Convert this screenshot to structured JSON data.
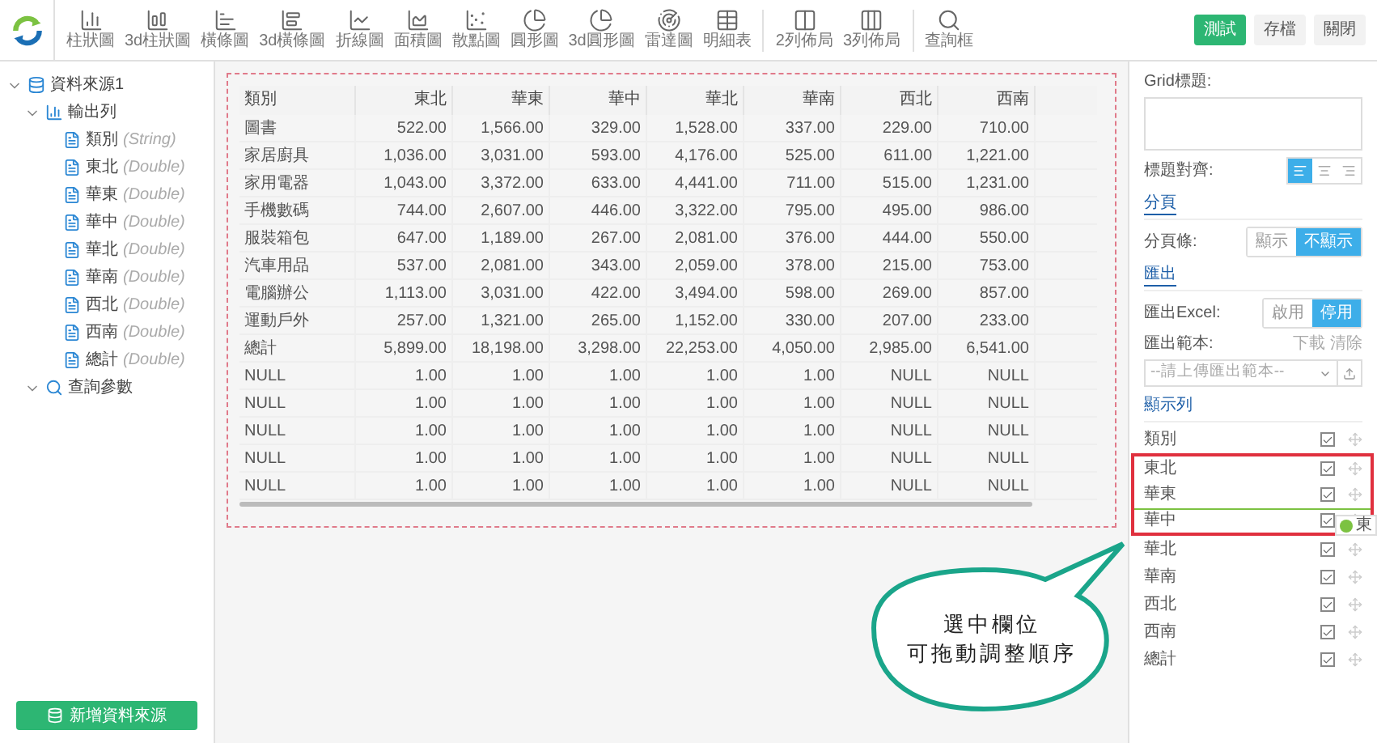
{
  "toolbar": {
    "tools": [
      {
        "kind": "column",
        "label": "柱狀圖"
      },
      {
        "kind": "column3d",
        "label": "3d柱狀圖"
      },
      {
        "kind": "bar",
        "label": "橫條圖"
      },
      {
        "kind": "bar3d",
        "label": "3d橫條圖"
      },
      {
        "kind": "line",
        "label": "折線圖"
      },
      {
        "kind": "area",
        "label": "面積圖"
      },
      {
        "kind": "scatter",
        "label": "散點圖"
      },
      {
        "kind": "pie",
        "label": "圓形圖"
      },
      {
        "kind": "pie3d",
        "label": "3d圓形圖"
      },
      {
        "kind": "radar",
        "label": "雷達圖"
      },
      {
        "kind": "table",
        "label": "明細表"
      },
      {
        "kind": "cols2",
        "label": "2列佈局"
      },
      {
        "kind": "cols3",
        "label": "3列佈局"
      },
      {
        "kind": "query",
        "label": "查詢框"
      }
    ],
    "actions": [
      {
        "label": "測試",
        "primary": true
      },
      {
        "label": "存檔",
        "primary": false
      },
      {
        "label": "關閉",
        "primary": false
      }
    ]
  },
  "sidebar": {
    "tree": [
      {
        "kind": "source",
        "label": "資料來源1",
        "expanded": true,
        "children": [
          {
            "kind": "group",
            "label": "輸出列",
            "expanded": true,
            "children": [
              {
                "kind": "field",
                "label": "類別",
                "type": "(String)"
              },
              {
                "kind": "field",
                "label": "東北",
                "type": "(Double)"
              },
              {
                "kind": "field",
                "label": "華東",
                "type": "(Double)"
              },
              {
                "kind": "field",
                "label": "華中",
                "type": "(Double)"
              },
              {
                "kind": "field",
                "label": "華北",
                "type": "(Double)"
              },
              {
                "kind": "field",
                "label": "華南",
                "type": "(Double)"
              },
              {
                "kind": "field",
                "label": "西北",
                "type": "(Double)"
              },
              {
                "kind": "field",
                "label": "西南",
                "type": "(Double)"
              },
              {
                "kind": "field",
                "label": "總計",
                "type": "(Double)"
              }
            ]
          },
          {
            "kind": "query",
            "label": "查詢參數",
            "expanded": true
          }
        ]
      }
    ],
    "add_button": "新增資料來源"
  },
  "table": {
    "columns": [
      "類別",
      "東北",
      "華東",
      "華中",
      "華北",
      "華南",
      "西北",
      "西南"
    ],
    "rows": [
      [
        "圖書",
        "522.00",
        "1,566.00",
        "329.00",
        "1,528.00",
        "337.00",
        "229.00",
        "710.00"
      ],
      [
        "家居廚具",
        "1,036.00",
        "3,031.00",
        "593.00",
        "4,176.00",
        "525.00",
        "611.00",
        "1,221.00"
      ],
      [
        "家用電器",
        "1,043.00",
        "3,372.00",
        "633.00",
        "4,441.00",
        "711.00",
        "515.00",
        "1,231.00"
      ],
      [
        "手機數碼",
        "744.00",
        "2,607.00",
        "446.00",
        "3,322.00",
        "795.00",
        "495.00",
        "986.00"
      ],
      [
        "服裝箱包",
        "647.00",
        "1,189.00",
        "267.00",
        "2,081.00",
        "376.00",
        "444.00",
        "550.00"
      ],
      [
        "汽車用品",
        "537.00",
        "2,081.00",
        "343.00",
        "2,059.00",
        "378.00",
        "215.00",
        "753.00"
      ],
      [
        "電腦辦公",
        "1,113.00",
        "3,031.00",
        "422.00",
        "3,494.00",
        "598.00",
        "269.00",
        "857.00"
      ],
      [
        "運動戶外",
        "257.00",
        "1,321.00",
        "265.00",
        "1,152.00",
        "330.00",
        "207.00",
        "233.00"
      ],
      [
        "總計",
        "5,899.00",
        "18,198.00",
        "3,298.00",
        "22,253.00",
        "4,050.00",
        "2,985.00",
        "6,541.00"
      ],
      [
        "NULL",
        "1.00",
        "1.00",
        "1.00",
        "1.00",
        "1.00",
        "NULL",
        "NULL"
      ],
      [
        "NULL",
        "1.00",
        "1.00",
        "1.00",
        "1.00",
        "1.00",
        "NULL",
        "NULL"
      ],
      [
        "NULL",
        "1.00",
        "1.00",
        "1.00",
        "1.00",
        "1.00",
        "NULL",
        "NULL"
      ],
      [
        "NULL",
        "1.00",
        "1.00",
        "1.00",
        "1.00",
        "1.00",
        "NULL",
        "NULL"
      ],
      [
        "NULL",
        "1.00",
        "1.00",
        "1.00",
        "1.00",
        "1.00",
        "NULL",
        "NULL"
      ]
    ]
  },
  "properties": {
    "grid_title_label": "Grid標題:",
    "title_align": {
      "label": "標題對齊:",
      "options": [
        {
          "kind": "left",
          "selected": true
        },
        {
          "kind": "center",
          "selected": false
        },
        {
          "kind": "right",
          "selected": false
        }
      ]
    },
    "paging": {
      "heading": "分頁",
      "label": "分頁條:",
      "options": [
        {
          "label": "顯示",
          "selected": false
        },
        {
          "label": "不顯示",
          "selected": true
        }
      ]
    },
    "export": {
      "heading": "匯出",
      "label": "匯出Excel:",
      "options": [
        {
          "label": "啟用",
          "selected": false
        },
        {
          "label": "停用",
          "selected": true
        }
      ],
      "template_label": "匯出範本:",
      "download": "下載",
      "clear": "清除",
      "template_placeholder": "--請上傳匯出範本--"
    },
    "display": {
      "heading": "顯示列",
      "drag_ghost": "東",
      "columns": [
        {
          "label": "類別",
          "checked": true,
          "highlighted": false,
          "insert_before": false
        },
        {
          "label": "東北",
          "checked": true,
          "highlighted": true,
          "insert_before": false
        },
        {
          "label": "華東",
          "checked": true,
          "highlighted": true,
          "insert_before": false
        },
        {
          "label": "華中",
          "checked": true,
          "highlighted": true,
          "insert_before": true
        },
        {
          "label": "華北",
          "checked": true,
          "highlighted": false,
          "insert_before": false
        },
        {
          "label": "華南",
          "checked": true,
          "highlighted": false,
          "insert_before": false
        },
        {
          "label": "西北",
          "checked": true,
          "highlighted": false,
          "insert_before": false
        },
        {
          "label": "西南",
          "checked": true,
          "highlighted": false,
          "insert_before": false
        },
        {
          "label": "總計",
          "checked": true,
          "highlighted": false,
          "insert_before": false
        }
      ]
    }
  },
  "callout": {
    "lines": [
      "選中欄位",
      "可拖動調整順序"
    ]
  }
}
